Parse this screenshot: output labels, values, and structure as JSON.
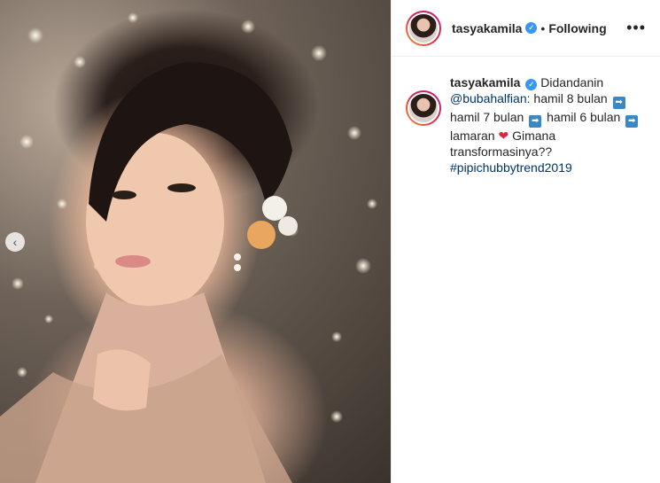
{
  "post": {
    "username": "tasyakamila",
    "follow_status": "Following",
    "separator": "•",
    "more_icon": "more-horizontal-icon"
  },
  "caption": {
    "username": "tasyakamila",
    "text_1": "Didandanin",
    "mention": "@bubahalfian",
    "text_2": ": hamil 8 bulan",
    "text_3": "hamil 7 bulan",
    "text_4": "hamil 6 bulan",
    "text_5": "lamaran",
    "text_6": "Gimana transformasinya??",
    "hashtag": "#pipichubbytrend2019"
  },
  "icons": {
    "arrow": "➡",
    "heart": "❤",
    "verified": "✓",
    "carousel_prev": "‹"
  },
  "colors": {
    "link": "#003569",
    "verified": "#3897f0",
    "border": "#efefef"
  }
}
